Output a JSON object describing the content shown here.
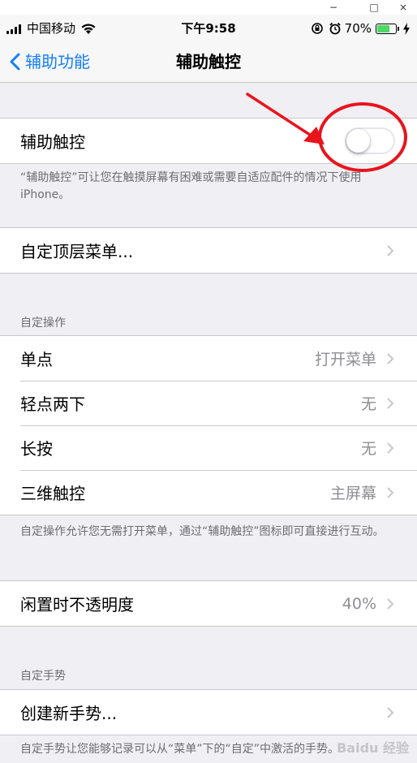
{
  "window_controls": {
    "minimize": "−",
    "maximize": "□",
    "close": "×"
  },
  "status": {
    "carrier": "中国移动",
    "time": "下午9:58",
    "battery_percent": "70%",
    "battery_level": 0.7,
    "battery_color": "#4cd964"
  },
  "nav": {
    "back_label": "辅助功能",
    "title": "辅助触控"
  },
  "main_toggle": {
    "label": "辅助触控",
    "on": false
  },
  "main_footer": "“辅助触控”可让您在触摸屏幕有困难或需要自适应配件的情况下使用 iPhone。",
  "top_menu": {
    "label": "自定顶层菜单..."
  },
  "custom_actions": {
    "header": "自定操作",
    "items": [
      {
        "label": "单点",
        "value": "打开菜单"
      },
      {
        "label": "轻点两下",
        "value": "无"
      },
      {
        "label": "长按",
        "value": "无"
      },
      {
        "label": "三维触控",
        "value": "主屏幕"
      }
    ],
    "footer": "自定操作允许您无需打开菜单，通过“辅助触控”图标即可直接进行互动。"
  },
  "idle_opacity": {
    "label": "闲置时不透明度",
    "value": "40%"
  },
  "custom_gestures": {
    "header": "自定手势",
    "create_label": "创建新手势...",
    "footer": "自定手势让您能够记录可以从“菜单”下的“自定”中激活的手势。"
  },
  "watermark": "Baidu 经验",
  "colors": {
    "accent": "#157efb",
    "annotation": "#e8141c",
    "background": "#efeff4"
  },
  "icons": [
    "signal-icon",
    "wifi-icon",
    "lock-rotation-icon",
    "alarm-icon",
    "battery-icon",
    "charging-icon",
    "back-chevron-icon",
    "chevron-right-icon"
  ]
}
